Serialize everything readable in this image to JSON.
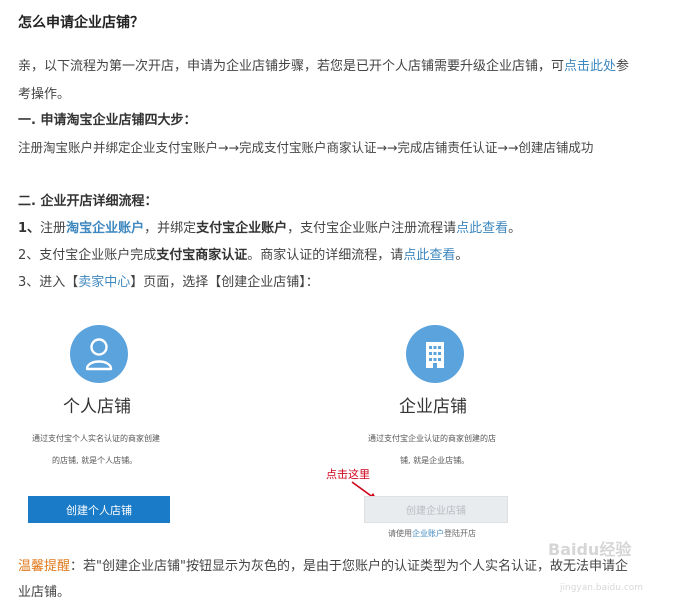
{
  "title": "怎么申请企业店铺？",
  "intro": {
    "text1": "亲，以下流程为第一次开店，申请为企业店铺步骤，若您是已开个人店铺需要升级企业店铺，可",
    "link": "点击此处",
    "text2": "参",
    "text3": "考操作。"
  },
  "section1": {
    "heading": "一. 申请淘宝企业店铺四大步：",
    "steps": "注册淘宝账户并绑定企业支付宝账户→→完成支付宝账户商家认证→→完成店铺责任认证→→创建店铺成功"
  },
  "section2": {
    "heading": "二. 企业开店详细流程：",
    "step1": {
      "num": "1、",
      "a": "注册",
      "link1": "淘宝企业账户",
      "b": "，并绑定",
      "bold": "支付宝企业账户",
      "c": "，支付宝企业账户注册流程请",
      "link2": "点此查看",
      "d": "。"
    },
    "step2": {
      "a": "2、支付宝企业账户完成",
      "bold": "支付宝商家认证",
      "b": "。商家认证的详细流程，请",
      "link": "点此查看",
      "c": "。"
    },
    "step3": {
      "a": "3、进入【",
      "link": "卖家中心",
      "b": "】页面，选择【创建企业店铺】："
    }
  },
  "personal": {
    "icon": "user-icon",
    "title": "个人店铺",
    "desc1": "通过支付宝个人实名认证的商家创建",
    "desc2": "的店铺, 就是个人店铺。",
    "button": "创建个人店铺"
  },
  "enterprise": {
    "icon": "building-icon",
    "title": "企业店铺",
    "desc1": "通过支付宝企业认证的商家创建的店",
    "desc2": "铺, 就是企业店铺。",
    "annotation": "点击这里",
    "button": "创建企业店铺",
    "note_a": "请使用",
    "note_link": "企业账户",
    "note_b": "登陆开店"
  },
  "tip": {
    "label": "温馨提醒",
    "text1": "：若\"创建企业店铺\"按钮显示为灰色的，是由于您账户的认证类型为个人实名认证，故无法申请企",
    "text2": "业店铺。"
  },
  "watermark": {
    "brand": "Baidu经验",
    "url": "jingyan.baidu.com"
  },
  "colors": {
    "link": "#3f88bf",
    "icon_circle": "#5ba3dc",
    "primary_button": "#1a7bc8",
    "warning": "#e07a1c",
    "arrow": "#d0021b"
  }
}
